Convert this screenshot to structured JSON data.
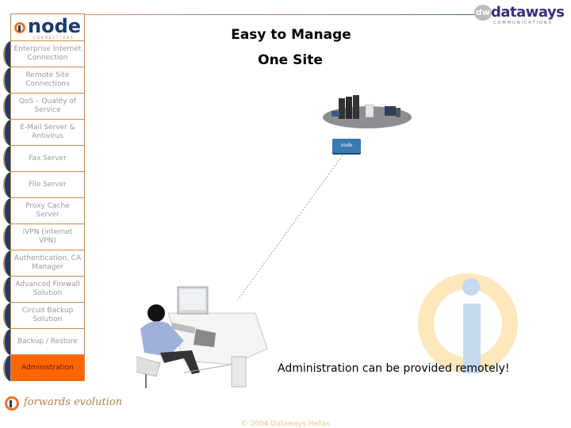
{
  "header": {
    "left_logo": {
      "name": "node",
      "subtitle": "CONNECTIONS"
    },
    "right_logo": {
      "name": "dataways",
      "subtitle": "COMMUNICATIONS",
      "mark": "dw"
    }
  },
  "titles": {
    "main": "Easy to Manage",
    "sub": "One Site"
  },
  "nav": {
    "items": [
      {
        "label": "Enterprise Internet Connection",
        "active": false
      },
      {
        "label": "Remote Site Connections",
        "active": false
      },
      {
        "label": "QoS – Quality of Service",
        "active": false
      },
      {
        "label": "E-Mail Server & Antivirus",
        "active": false
      },
      {
        "label": "Fax Server",
        "active": false
      },
      {
        "label": "File Server",
        "active": false
      },
      {
        "label": "Proxy Cache Server",
        "active": false
      },
      {
        "label": "iVPN (internet VPN)",
        "active": false
      },
      {
        "label": "Authentication, CA Manager",
        "active": false
      },
      {
        "label": "Advanced Firewall Solution",
        "active": false
      },
      {
        "label": "Circuit Backup Solution",
        "active": false
      },
      {
        "label": "Backup / Restore",
        "active": false
      },
      {
        "label": "Administration",
        "active": true
      }
    ]
  },
  "diagram": {
    "router_label": "node",
    "caption": "Administration can be provided remotely!"
  },
  "footer": {
    "slogan": "forwards evolution",
    "copyright": "© 2004 Dataways Hellas"
  },
  "colors": {
    "accent": "#ff6600",
    "navy": "#1f3a6a",
    "border": "#d08a40"
  }
}
